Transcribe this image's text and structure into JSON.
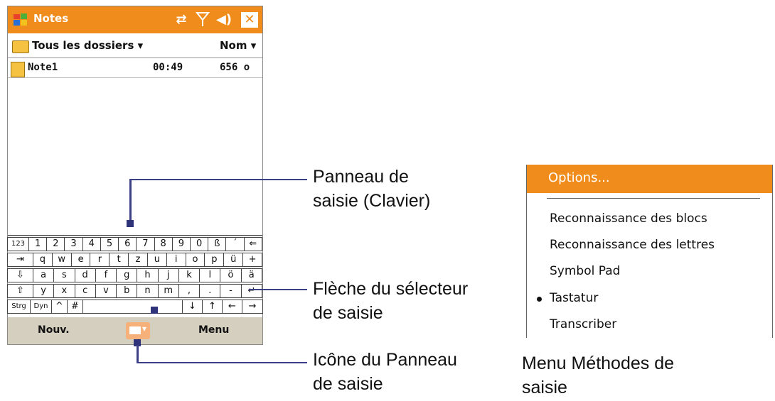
{
  "device": {
    "title": "Notes",
    "folder_label": "Tous les dossiers",
    "sort_label": "Nom",
    "note": {
      "name": "Note1",
      "time": "00:49",
      "size": "656 o"
    },
    "keyboard_rows": [
      [
        "123",
        "1",
        "2",
        "3",
        "4",
        "5",
        "6",
        "7",
        "8",
        "9",
        "0",
        "ß",
        "´",
        "⇐"
      ],
      [
        "⇥",
        "q",
        "w",
        "e",
        "r",
        "t",
        "z",
        "u",
        "i",
        "o",
        "p",
        "ü",
        "+"
      ],
      [
        "⇩",
        "a",
        "s",
        "d",
        "f",
        "g",
        "h",
        "j",
        "k",
        "l",
        "ö",
        "ä"
      ],
      [
        "⇧",
        "y",
        "x",
        "c",
        "v",
        "b",
        "n",
        "m",
        ",",
        ".",
        "-",
        "↵"
      ],
      [
        "Strg",
        "Dyn",
        "^",
        "#",
        "",
        "↓",
        "↑",
        "←",
        "→"
      ]
    ],
    "softkey_left": "Nouv.",
    "softkey_right": "Menu"
  },
  "callouts": {
    "input_panel_line1": "Panneau de",
    "input_panel_line2": "saisie (Clavier)",
    "selector_line1": "Flèche du sélecteur",
    "selector_line2": "de saisie",
    "icon_line1": "Icône du Panneau",
    "icon_line2": "de saisie",
    "menu_line1": "Menu Méthodes de",
    "menu_line2": "saisie"
  },
  "menu": {
    "options": "Options...",
    "items": [
      "Reconnaissance des blocs",
      "Reconnaissance des lettres",
      "Symbol Pad",
      "Tastatur",
      "Transcriber"
    ],
    "selected": "Tastatur"
  },
  "colors": {
    "accent": "#f08c1c",
    "callout_line": "#3b3f86",
    "softbar": "#d5cfc0"
  }
}
